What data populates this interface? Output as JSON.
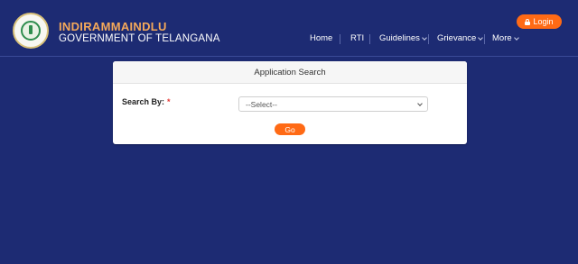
{
  "header": {
    "brand_title": "INDIRAMMAINDLU",
    "brand_subtitle": "GOVERNMENT OF TELANGANA",
    "login_label": "Login",
    "login_icon": "lock-icon"
  },
  "nav": {
    "items": [
      {
        "label": "Home"
      },
      {
        "label": "RTI"
      },
      {
        "label": "Guidelines",
        "dropdown": true
      },
      {
        "label": "Grievance",
        "dropdown": true
      },
      {
        "label": "More",
        "dropdown": true
      }
    ]
  },
  "card": {
    "title": "Application Search",
    "search_by_label": "Search By:",
    "required_marker": "*",
    "select_value": "--Select--",
    "go_label": "Go"
  },
  "colors": {
    "background": "#1d2b73",
    "accent": "#ff6a15",
    "brand_title": "#f5a95a"
  }
}
